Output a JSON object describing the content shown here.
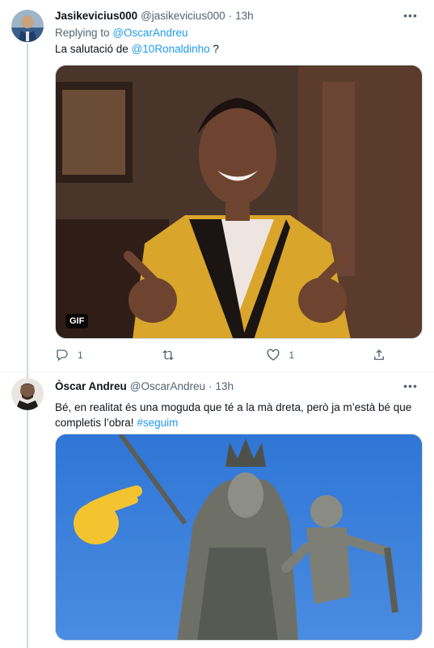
{
  "tweet1": {
    "name": "Jasikevicius000",
    "handle": "@jasikevicius000",
    "time": "13h",
    "replying_prefix": "Replying to",
    "replying_to": "@OscarAndreu",
    "text_before": "La salutació de",
    "mention": "@10Ronaldinho",
    "text_after": " ?",
    "gif_label": "GIF",
    "replies": "1",
    "retweets": "",
    "likes": "1"
  },
  "tweet2": {
    "name": "Òscar Andreu",
    "handle": "@OscarAndreu",
    "time": "13h",
    "text": "Bé, en realitat és una moguda que té a la mà dreta, però ja m’està bé que completis l’obra!",
    "hashtag": "#seguim"
  },
  "icons": {
    "more": "more-icon",
    "reply": "reply-icon",
    "retweet": "retweet-icon",
    "like": "heart-icon",
    "share": "share-icon"
  },
  "colors": {
    "link": "#1d9bf0",
    "secondary_text": "#536471",
    "primary_text": "#0f1419",
    "thread_line": "#cfd9de"
  }
}
